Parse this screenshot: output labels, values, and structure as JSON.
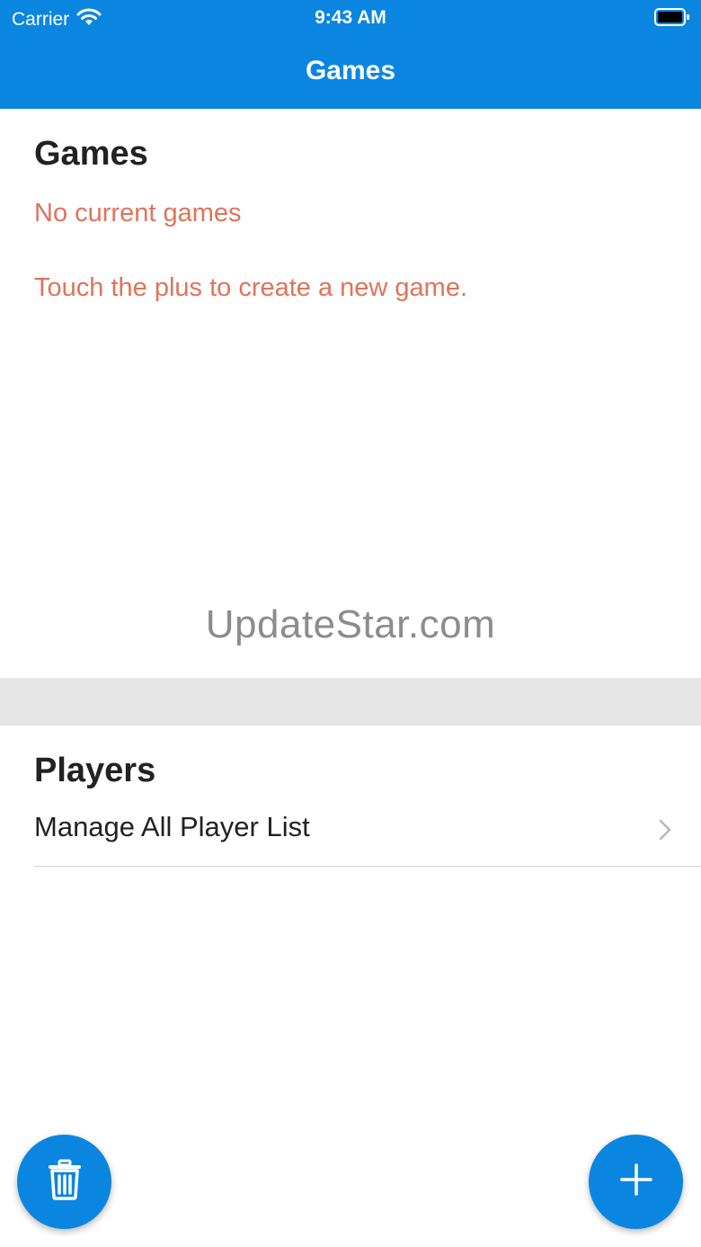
{
  "status_bar": {
    "carrier": "Carrier",
    "time": "9:43 AM",
    "icons": [
      "wifi-icon",
      "battery-icon"
    ]
  },
  "nav": {
    "title": "Games"
  },
  "games_section": {
    "title": "Games",
    "empty_message": "No current games",
    "hint": "Touch the plus to create a new game."
  },
  "watermark": "UpdateStar.com",
  "players_section": {
    "title": "Players",
    "items": [
      {
        "label": "Manage All Player List",
        "icon": "chevron-right-icon"
      }
    ]
  },
  "fabs": {
    "delete_icon": "trash-icon",
    "add_icon": "plus-icon"
  },
  "colors": {
    "accent": "#0b86e0",
    "empty_text": "#e0735b",
    "section_band": "#e6e6e6"
  }
}
